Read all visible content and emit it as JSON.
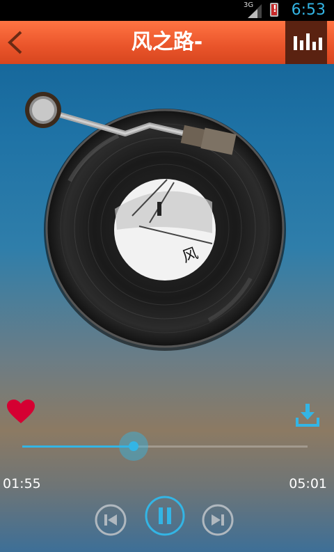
{
  "status_bar": {
    "network": "3G",
    "time": "6:53",
    "battery_mark": "!"
  },
  "header": {
    "title": "风之路-",
    "back_icon": "chevron-left-icon",
    "equalizer_icon": "equalizer-icon"
  },
  "player": {
    "favorite_icon": "heart-icon",
    "download_icon": "download-icon",
    "elapsed": "01:55",
    "total": "05:01",
    "progress": 0.38,
    "controls": {
      "previous_icon": "skip-previous-icon",
      "pause_icon": "pause-icon",
      "next_icon": "skip-next-icon"
    }
  },
  "colors": {
    "accent": "#33b5e5",
    "header": "#e9542a",
    "heart": "#d50032"
  }
}
